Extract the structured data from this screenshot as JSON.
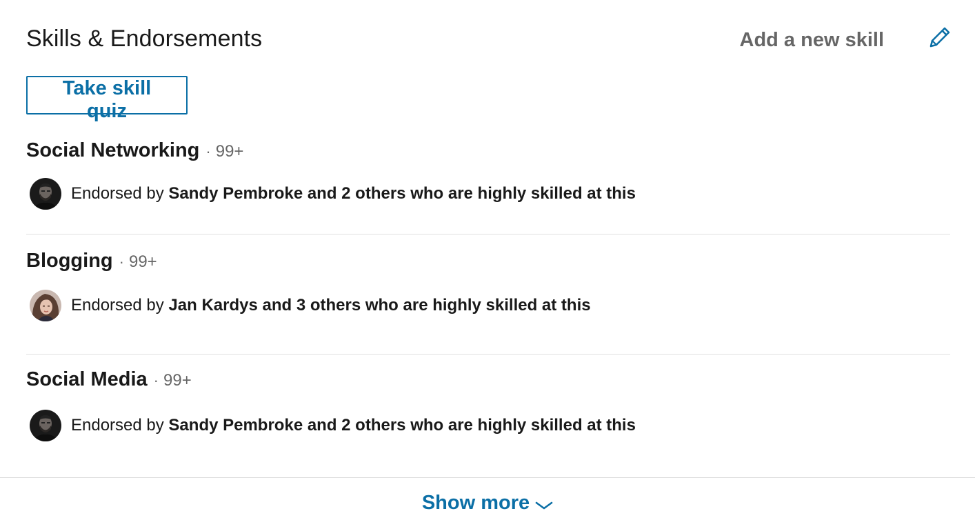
{
  "section": {
    "title": "Skills & Endorsements",
    "add_skill_label": "Add a new skill",
    "quiz_label": "Take skill quiz",
    "show_more_label": "Show more"
  },
  "skills": [
    {
      "name": "Social Networking",
      "separator": "·",
      "count": "99+",
      "endorse_prefix": "Endorsed by ",
      "endorse_strong": "Sandy Pembroke and 2 others who are highly skilled at this",
      "avatar": "man-avatar"
    },
    {
      "name": "Blogging",
      "separator": "·",
      "count": "99+",
      "endorse_prefix": "Endorsed by ",
      "endorse_strong": "Jan Kardys and 3 others who are highly skilled at this",
      "avatar": "woman-avatar"
    },
    {
      "name": "Social Media",
      "separator": "·",
      "count": "99+",
      "endorse_prefix": "Endorsed by ",
      "endorse_strong": "Sandy Pembroke and 2 others who are highly skilled at this",
      "avatar": "man-avatar"
    }
  ],
  "icons": {
    "edit": "pencil-icon",
    "show_more": "chevron-down-icon"
  },
  "colors": {
    "accent": "#0b6fa6",
    "divider": "#e0e0e0",
    "muted_text": "#666666"
  }
}
